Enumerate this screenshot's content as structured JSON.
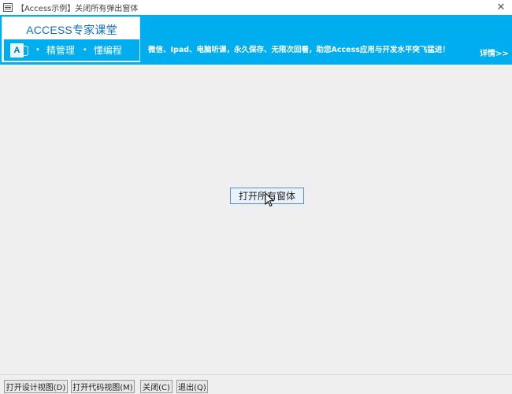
{
  "window": {
    "title": "【Access示例】关闭所有弹出窗体",
    "close_glyph": "✕"
  },
  "banner": {
    "brand_title": "ACCESS专家课堂",
    "logo_letter": "A",
    "strip_items": [
      "精管理",
      "懂编程"
    ],
    "bullet": "•",
    "slogan": "微信、Ipad、电脑听课，永久保存、无限次回看，助您Access应用与开发水平突飞猛进！",
    "details": "详情>>",
    "colors": {
      "accent": "#00adef",
      "brand_text": "#0f6fc6"
    }
  },
  "main": {
    "open_all_label": "打开所有窗体"
  },
  "bottom_bar": {
    "design_view": "打开设计视图(D)",
    "code_view": "打开代码视图(M)",
    "close": "关闭(C)",
    "exit": "退出(Q)"
  }
}
